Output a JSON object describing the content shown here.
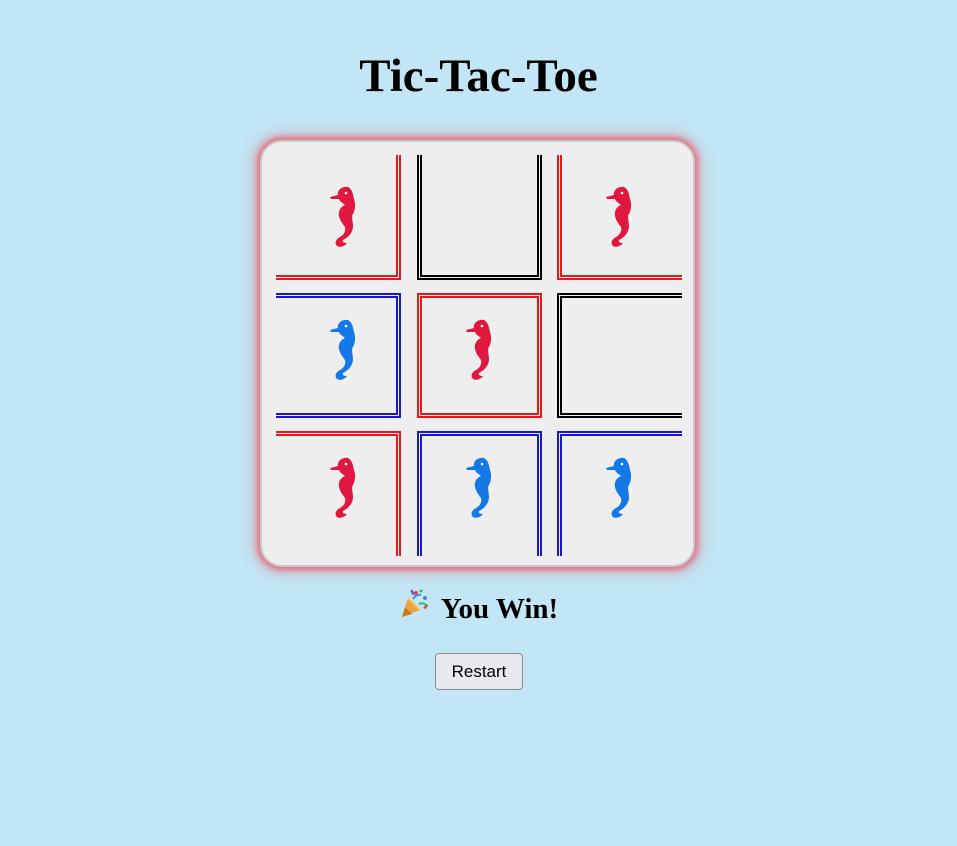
{
  "title": "Tic-Tac-Toe",
  "board": {
    "cells": [
      {
        "mark": "seahorse-red",
        "border_color": "#e4191c"
      },
      {
        "mark": "",
        "border_color": "#000000"
      },
      {
        "mark": "seahorse-red",
        "border_color": "#e4191c"
      },
      {
        "mark": "seahorse-blue",
        "border_color": "#1818c8"
      },
      {
        "mark": "seahorse-red",
        "border_color": "#e4191c"
      },
      {
        "mark": "",
        "border_color": "#000000"
      },
      {
        "mark": "seahorse-red",
        "border_color": "#e4191c"
      },
      {
        "mark": "seahorse-blue",
        "border_color": "#1818c8"
      },
      {
        "mark": "seahorse-blue",
        "border_color": "#1818c8"
      }
    ]
  },
  "status": {
    "icon": "party-popper-icon",
    "text": "You Win!"
  },
  "restart_label": "Restart",
  "colors": {
    "background": "#c2e6f5",
    "board": "#efeeee",
    "red_piece": "#e0173f",
    "blue_piece": "#1479e6",
    "glow": "#eb5a69"
  }
}
